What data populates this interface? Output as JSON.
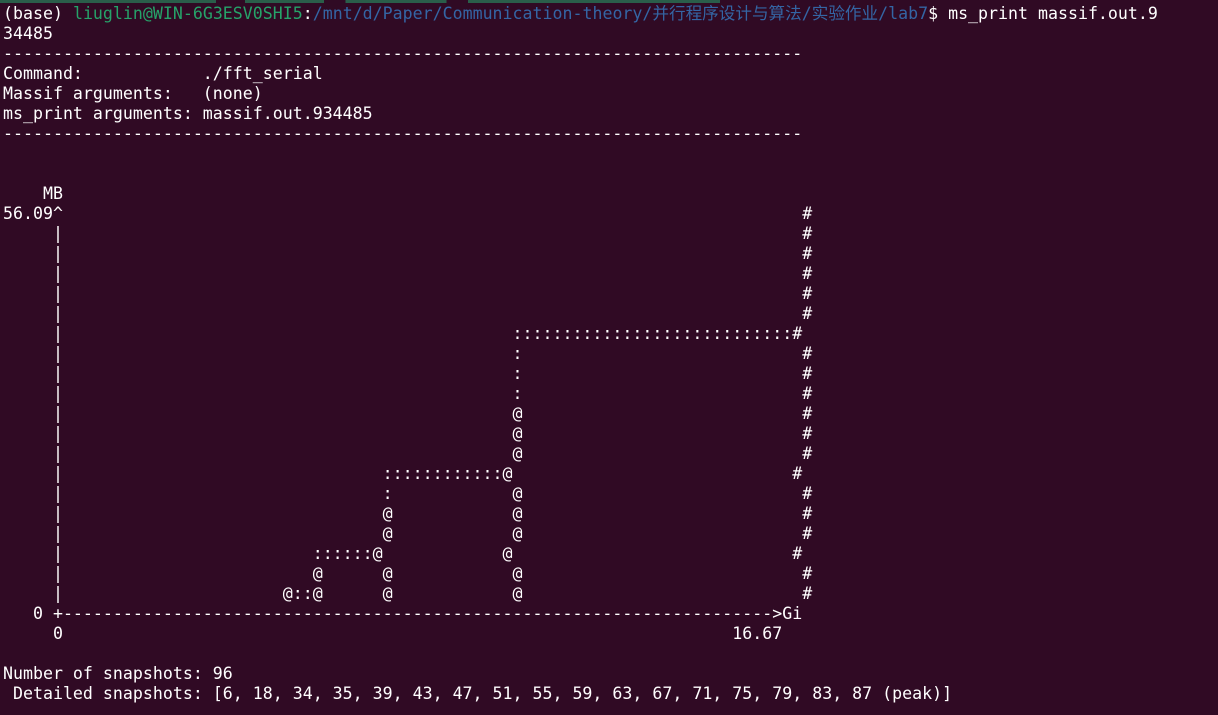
{
  "colors": {
    "background": "#300a24",
    "text": "#ffffff",
    "user_host": "#26a269",
    "path": "#3465a4"
  },
  "prompt": {
    "env": "(base)",
    "user_host": "liuglin@WIN-6G3ESV0SHI5",
    "separator": ":",
    "path": "/mnt/d/Paper/Communication-theory/并行程序设计与算法/实验作业/lab7",
    "symbol": "$",
    "command": "ms_print massif.out.9",
    "command_wrap": "34485"
  },
  "output": {
    "rule": "--------------------------------------------------------------------------------",
    "info": [
      "Command:            ./fft_serial",
      "Massif arguments:   (none)",
      "ms_print arguments: massif.out.934485"
    ],
    "graph": [
      "    MB",
      "56.09^                                                                          #",
      "     |                                                                          #",
      "     |                                                                          #",
      "     |                                                                          #",
      "     |                                                                          #",
      "     |                                                                          #",
      "     |                                             ::::::::::::::::::::::::::::#",
      "     |                                             :                            #",
      "     |                                             :                            #",
      "     |                                             :                            #",
      "     |                                             @                            #",
      "     |                                             @                            #",
      "     |                                             @                            #",
      "     |                                ::::::::::::@                            #",
      "     |                                :            @                            #",
      "     |                                @            @                            #",
      "     |                                @            @                            #",
      "     |                         ::::::@            @                            #",
      "     |                         @      @            @                            #",
      "     |                      @::@      @            @                            #",
      "   0 +----------------------------------------------------------------------->Gi",
      "     0                                                                   16.67"
    ],
    "summary": [
      "Number of snapshots: 96",
      " Detailed snapshots: [6, 18, 34, 35, 39, 43, 47, 51, 55, 59, 63, 67, 71, 75, 79, 83, 87 (peak)]"
    ]
  }
}
